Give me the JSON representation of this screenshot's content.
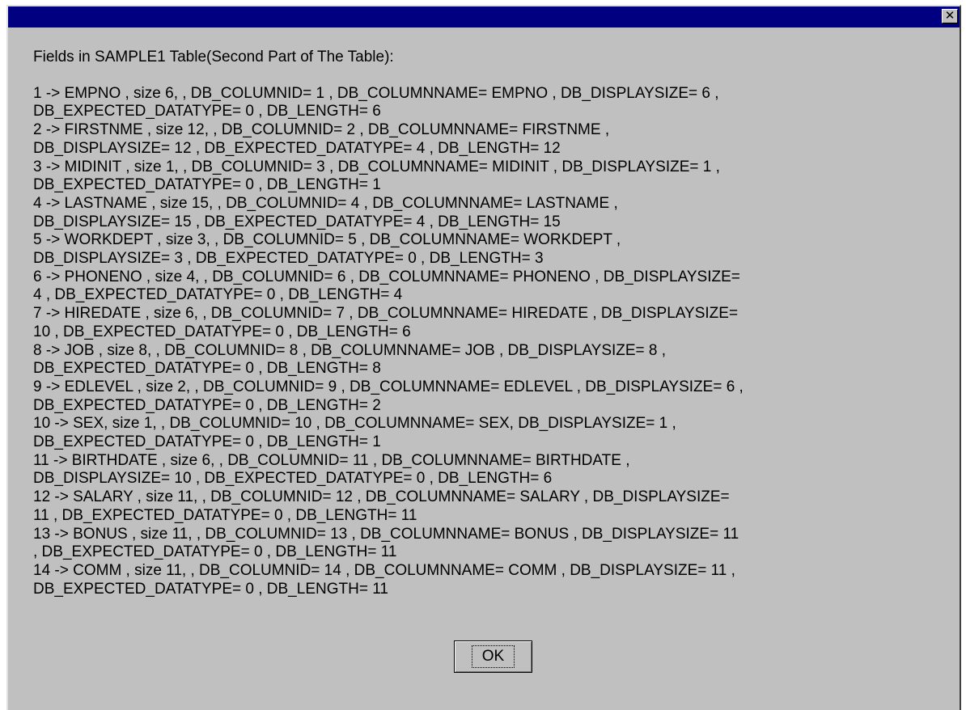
{
  "dialog": {
    "close_glyph": "✕",
    "heading": "Fields in SAMPLE1 Table(Second Part of The Table):",
    "fields": [
      {
        "line1": "1 -> EMPNO , size 6, , DB_COLUMNID= 1 , DB_COLUMNNAME= EMPNO , DB_DISPLAYSIZE= 6 ,",
        "line2": "DB_EXPECTED_DATATYPE= 0 , DB_LENGTH= 6"
      },
      {
        "line1": "2 -> FIRSTNME , size 12, , DB_COLUMNID= 2 , DB_COLUMNNAME= FIRSTNME ,",
        "line2": "DB_DISPLAYSIZE= 12 , DB_EXPECTED_DATATYPE= 4 , DB_LENGTH= 12"
      },
      {
        "line1": "3 -> MIDINIT , size 1, , DB_COLUMNID= 3 , DB_COLUMNNAME= MIDINIT , DB_DISPLAYSIZE= 1 ,",
        "line2": "DB_EXPECTED_DATATYPE= 0 , DB_LENGTH= 1"
      },
      {
        "line1": "4 -> LASTNAME , size 15, , DB_COLUMNID= 4 , DB_COLUMNNAME= LASTNAME ,",
        "line2": "DB_DISPLAYSIZE= 15 , DB_EXPECTED_DATATYPE= 4 , DB_LENGTH= 15"
      },
      {
        "line1": "5 -> WORKDEPT , size 3, , DB_COLUMNID= 5 , DB_COLUMNNAME= WORKDEPT ,",
        "line2": "DB_DISPLAYSIZE= 3 , DB_EXPECTED_DATATYPE= 0 , DB_LENGTH= 3"
      },
      {
        "line1": "6 -> PHONENO , size 4, , DB_COLUMNID= 6 , DB_COLUMNNAME= PHONENO , DB_DISPLAYSIZE=",
        "line2": "4 , DB_EXPECTED_DATATYPE= 0 , DB_LENGTH= 4"
      },
      {
        "line1": "7 -> HIREDATE , size 6, , DB_COLUMNID= 7 , DB_COLUMNNAME= HIREDATE , DB_DISPLAYSIZE=",
        "line2": "10 , DB_EXPECTED_DATATYPE= 0 , DB_LENGTH= 6"
      },
      {
        "line1": "8 -> JOB , size 8, , DB_COLUMNID= 8 , DB_COLUMNNAME= JOB , DB_DISPLAYSIZE= 8 ,",
        "line2": "DB_EXPECTED_DATATYPE= 0 , DB_LENGTH= 8"
      },
      {
        "line1": "9 -> EDLEVEL , size 2, , DB_COLUMNID= 9 , DB_COLUMNNAME= EDLEVEL , DB_DISPLAYSIZE= 6 ,",
        "line2": "DB_EXPECTED_DATATYPE= 0 , DB_LENGTH= 2"
      },
      {
        "line1": "10 -> SEX, size 1, , DB_COLUMNID= 10 , DB_COLUMNNAME= SEX, DB_DISPLAYSIZE= 1 ,",
        "line2": "DB_EXPECTED_DATATYPE= 0 , DB_LENGTH= 1"
      },
      {
        "line1": "11 -> BIRTHDATE , size 6, , DB_COLUMNID= 11 , DB_COLUMNNAME= BIRTHDATE ,",
        "line2": "DB_DISPLAYSIZE= 10 , DB_EXPECTED_DATATYPE= 0 , DB_LENGTH= 6"
      },
      {
        "line1": "12 -> SALARY , size 11, , DB_COLUMNID= 12 , DB_COLUMNNAME= SALARY , DB_DISPLAYSIZE=",
        "line2": "11 , DB_EXPECTED_DATATYPE= 0 , DB_LENGTH= 11"
      },
      {
        "line1": "13 -> BONUS , size 11, , DB_COLUMNID= 13 , DB_COLUMNNAME= BONUS , DB_DISPLAYSIZE= 11",
        "line2": ", DB_EXPECTED_DATATYPE= 0 , DB_LENGTH= 11"
      },
      {
        "line1": "14 -> COMM , size 11, , DB_COLUMNID= 14 , DB_COLUMNNAME= COMM , DB_DISPLAYSIZE= 11 ,",
        "line2": "DB_EXPECTED_DATATYPE= 0 , DB_LENGTH= 11"
      }
    ],
    "ok_label": "OK"
  },
  "colors": {
    "titlebar": "#000080",
    "face": "#c0c0c0",
    "text": "#000000"
  }
}
